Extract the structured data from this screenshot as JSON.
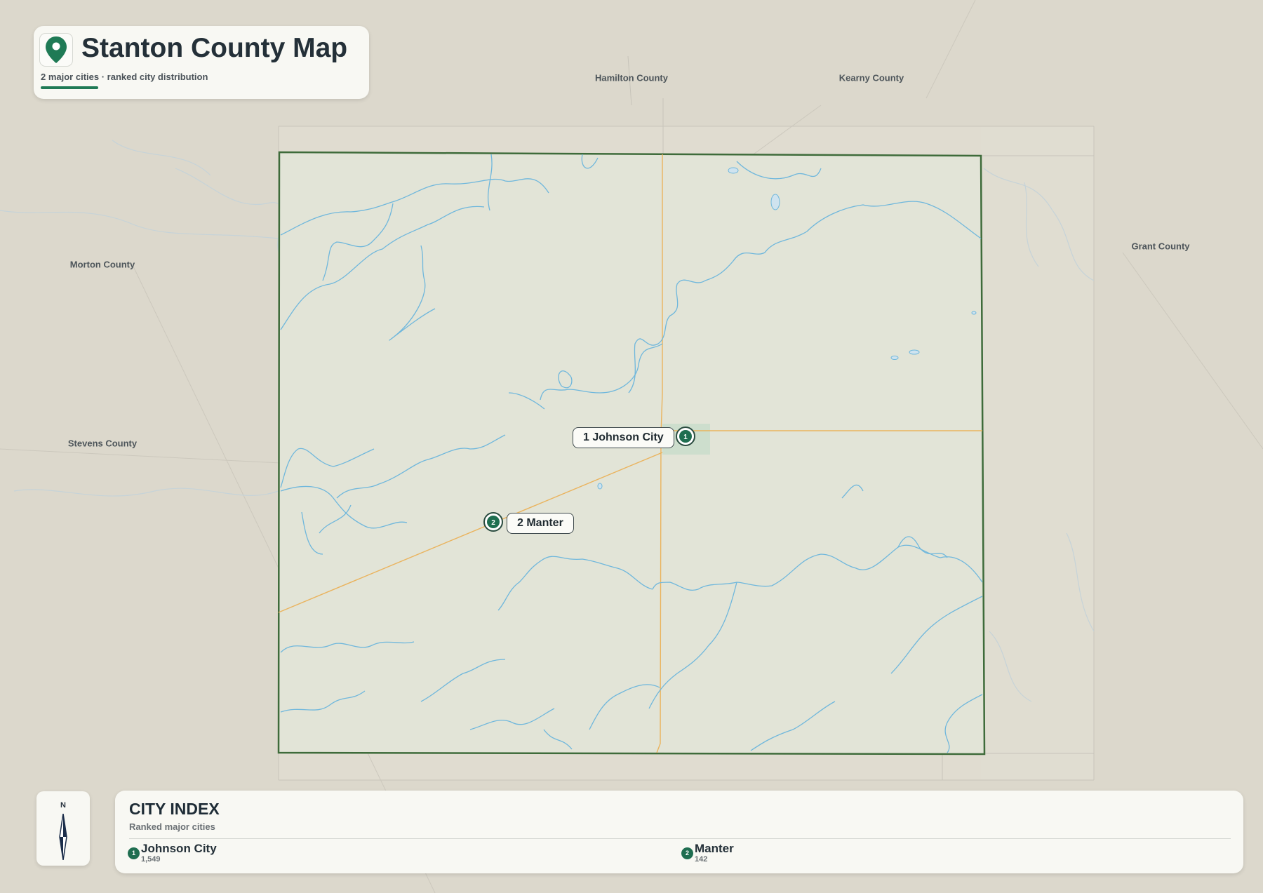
{
  "header": {
    "title": "Stanton County Map",
    "subtitle": "2 major cities · ranked city distribution",
    "pin_icon": "map-pin-icon"
  },
  "neighbor_counties": [
    {
      "id": "hamilton",
      "label": "Hamilton County"
    },
    {
      "id": "kearny",
      "label": "Kearny County"
    },
    {
      "id": "grant",
      "label": "Grant County"
    },
    {
      "id": "morton",
      "label": "Morton County"
    },
    {
      "id": "stevens",
      "label": "Stevens County"
    }
  ],
  "cities": [
    {
      "rank": "1",
      "map_label": "1 Johnson City",
      "name": "Johnson City",
      "population": "1,549"
    },
    {
      "rank": "2",
      "map_label": "2 Manter",
      "name": "Manter",
      "population": "142"
    }
  ],
  "compass": {
    "north_label": "N",
    "icon": "compass-arrow-icon"
  },
  "city_index": {
    "title": "CITY INDEX",
    "subtitle": "Ranked major cities"
  },
  "colors": {
    "accent": "#1f7a55",
    "marker": "#1f6e50",
    "county_border": "#3e6b3a",
    "county_fill": "#e2e4d7",
    "river": "#6fb7dc",
    "road": "#eab35d",
    "background": "#dcd8cc"
  }
}
